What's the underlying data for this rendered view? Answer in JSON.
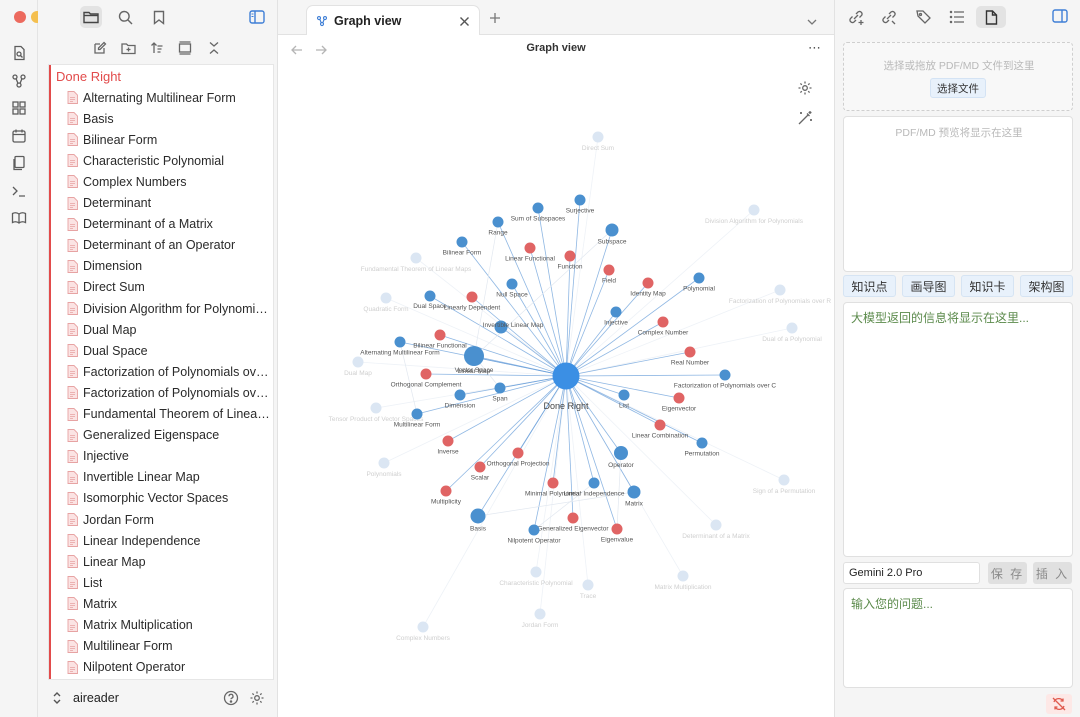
{
  "ribbon": {
    "traffic_colors": [
      "#ec6a5e",
      "#f4bf4f",
      "#61c554"
    ],
    "icons": [
      "quick-switcher-icon",
      "graph-icon",
      "canvas-icon",
      "daily-note-icon",
      "templates-icon",
      "command-palette-icon",
      "book-icon"
    ]
  },
  "sidebar": {
    "top_icons": [
      "files-icon",
      "search-icon",
      "bookmark-icon",
      "sidebar-toggle-icon"
    ],
    "toolbar_icons": [
      "new-note-icon",
      "new-folder-icon",
      "sort-icon",
      "collapse-icon",
      "collapse-all-icon"
    ],
    "root_folder": "Done Right",
    "files": [
      "Alternating Multilinear Form",
      "Basis",
      "Bilinear Form",
      "Characteristic Polynomial",
      "Complex Numbers",
      "Determinant",
      "Determinant of a Matrix",
      "Determinant of an Operator",
      "Dimension",
      "Direct Sum",
      "Division Algorithm for Polynomials",
      "Dual Map",
      "Dual Space",
      "Factorization of Polynomials over C",
      "Factorization of Polynomials over R",
      "Fundamental Theorem of Linear Algebra",
      "Generalized Eigenspace",
      "Injective",
      "Invertible Linear Map",
      "Isomorphic Vector Spaces",
      "Jordan Form",
      "Linear Independence",
      "Linear Map",
      "List",
      "Matrix",
      "Matrix Multiplication",
      "Multilinear Form",
      "Nilpotent Operator"
    ],
    "vault_name": "aireader"
  },
  "tab": {
    "title": "Graph view",
    "icon": "graph-icon"
  },
  "view": {
    "title": "Graph view"
  },
  "graph": {
    "center_node": "Done Right",
    "colors": {
      "blue": "#4a90cf",
      "red": "#e06464",
      "faded": "#dbe6f3",
      "edge": "#6a9fd9",
      "label": "#555555",
      "faded_label": "#cfcfcf"
    },
    "nodes": [
      {
        "label": "Range",
        "c": "b"
      },
      {
        "label": "Sum of Subspaces",
        "c": "b"
      },
      {
        "label": "Surjective",
        "c": "b"
      },
      {
        "label": "Subspace",
        "c": "b"
      },
      {
        "label": "Bilinear Form",
        "c": "b"
      },
      {
        "label": "Linear Functional",
        "c": "r"
      },
      {
        "label": "Function",
        "c": "r"
      },
      {
        "label": "Field",
        "c": "r"
      },
      {
        "label": "Identity Map",
        "c": "r"
      },
      {
        "label": "Polynomial",
        "c": "b"
      },
      {
        "label": "Null Space",
        "c": "b"
      },
      {
        "label": "Dual Space",
        "c": "b"
      },
      {
        "label": "Linearly Dependent",
        "c": "r"
      },
      {
        "label": "Invertible Linear Map",
        "c": "b"
      },
      {
        "label": "Injective",
        "c": "b"
      },
      {
        "label": "Complex Number",
        "c": "r"
      },
      {
        "label": "Vector Space",
        "c": "b"
      },
      {
        "label": "Bilinear Functional",
        "c": "r"
      },
      {
        "label": "Alternating Multilinear Form",
        "c": "b"
      },
      {
        "label": "Linear Map",
        "c": "b"
      },
      {
        "label": "Real Number",
        "c": "r"
      },
      {
        "label": "Orthogonal Complement",
        "c": "r"
      },
      {
        "label": "Factorization of Polynomials over C",
        "c": "b"
      },
      {
        "label": "Span",
        "c": "b"
      },
      {
        "label": "Dimension",
        "c": "b"
      },
      {
        "label": "List",
        "c": "b"
      },
      {
        "label": "Eigenvector",
        "c": "r"
      },
      {
        "label": "Multilinear Form",
        "c": "b"
      },
      {
        "label": "Linear Combination",
        "c": "r"
      },
      {
        "label": "Inverse",
        "c": "r"
      },
      {
        "label": "Permutation",
        "c": "b"
      },
      {
        "label": "Orthogonal Projection",
        "c": "r"
      },
      {
        "label": "Operator",
        "c": "b"
      },
      {
        "label": "Scalar",
        "c": "r"
      },
      {
        "label": "Minimal Polynomial",
        "c": "r"
      },
      {
        "label": "Linear Independence",
        "c": "b"
      },
      {
        "label": "Multiplicity",
        "c": "r"
      },
      {
        "label": "Matrix",
        "c": "b"
      },
      {
        "label": "Generalized Eigenvector",
        "c": "r"
      },
      {
        "label": "Basis",
        "c": "b"
      },
      {
        "label": "Nilpotent Operator",
        "c": "b"
      },
      {
        "label": "Eigenvalue",
        "c": "r"
      }
    ],
    "faded_nodes": [
      "Direct Sum",
      "Division Algorithm for Polynomials",
      "Fundamental Theorem of Linear Maps",
      "Quadratic Form",
      "Factorization of Polynomials over R",
      "Dual of a Polynomial",
      "Dual Map",
      "Tensor Product of Vector Spaces",
      "Polynomials",
      "Sign of a Permutation",
      "Determinant of a Matrix",
      "Characteristic Polynomial",
      "Trace",
      "Matrix Multiplication",
      "Jordan Form",
      "Complex Numbers"
    ]
  },
  "right_panel": {
    "top_icons": [
      "link-plus-icon",
      "link-icon",
      "tags-icon",
      "outline-icon",
      "file-icon",
      "sidebar-right-icon"
    ],
    "upload_hint": "选择或拖放 PDF/MD 文件到这里",
    "choose_file": "选择文件",
    "preview_hint": "PDF/MD 预览将显示在这里",
    "mode_buttons": [
      "知识点",
      "画导图",
      "知识卡",
      "架构图"
    ],
    "response_hint": "大模型返回的信息将显示在这里...",
    "model": "Gemini 2.0 Pro",
    "save_label": "保 存",
    "insert_label": "插 入",
    "question_placeholder": "输入您的问题..."
  }
}
